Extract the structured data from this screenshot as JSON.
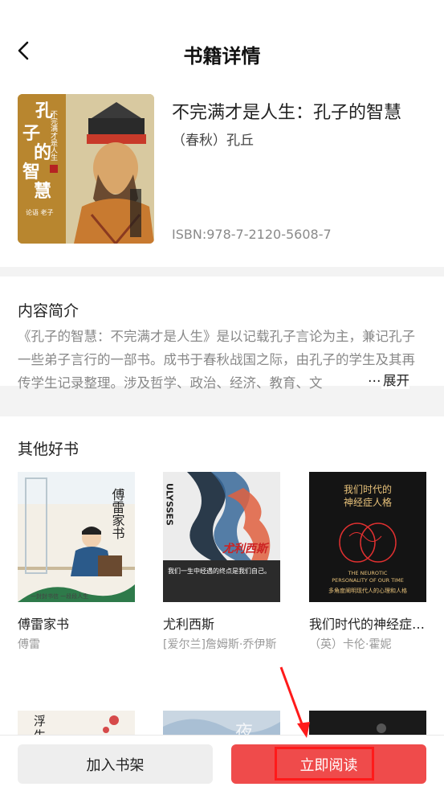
{
  "header": {
    "title": "书籍详情"
  },
  "book": {
    "title": "不完满才是人生：孔子的智慧",
    "author": "（春秋）孔丘",
    "isbn": "ISBN:978-7-2120-5608-7",
    "cover_text": {
      "title_chars": "孔子的智慧",
      "subtitle": "不完满才是人生",
      "badge": "论语 老子 孔丘学"
    }
  },
  "intro": {
    "title": "内容简介",
    "text": "《孔子的智慧：不完满才是人生》是以记载孔子言论为主，兼记孔子一些弟子言行的一部书。成书于春秋战国之际，由孔子的学生及其再传学生记录整理。涉及哲学、政治、经济、教育、文",
    "ellipsis": "…",
    "expand_label": "展开"
  },
  "others": {
    "title": "其他好书",
    "books": [
      {
        "title": "傅雷家书",
        "author": "傅雷",
        "cover_text": "傅雷家书",
        "cover_caption": "一封封书信 一段段人生"
      },
      {
        "title": "尤利西斯",
        "author": "[爱尔兰]詹姆斯·乔伊斯",
        "cover_text": "尤利西斯",
        "cover_spine": "ULYSSES",
        "cover_tagline": "我们一生中经遇的终点是我们自己。"
      },
      {
        "title": "我们时代的神经症人格",
        "author": "（英）卡伦·霍妮",
        "cover_text": "我们时代的神经症人格",
        "cover_en": "THE NEUROTIC PERSONALITY OF OUR TIME",
        "cover_sub": "多角度阐明现代人的心理和人格"
      }
    ],
    "peek_cover_text": "浮生"
  },
  "actions": {
    "add_shelf": "加入书架",
    "read_now": "立即阅读"
  },
  "colors": {
    "accent": "#ef4b4b",
    "annotation": "#ff1a1a"
  }
}
